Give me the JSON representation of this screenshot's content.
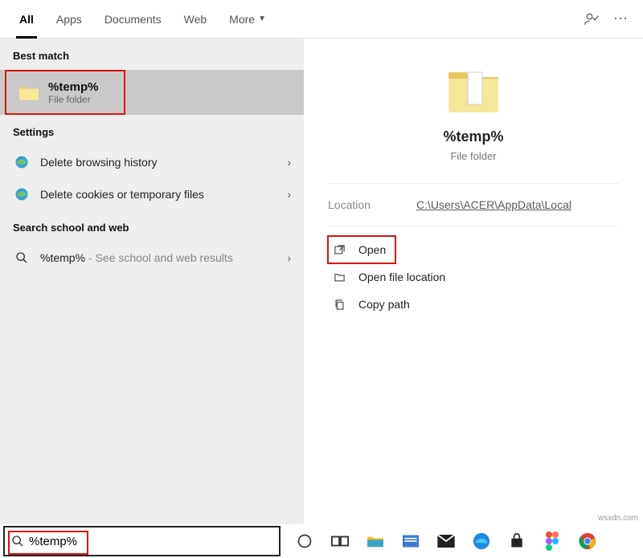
{
  "tabs": {
    "items": [
      "All",
      "Apps",
      "Documents",
      "Web",
      "More"
    ],
    "active_index": 0
  },
  "left": {
    "best_match_label": "Best match",
    "best_match": {
      "title": "%temp%",
      "subtitle": "File folder"
    },
    "settings_label": "Settings",
    "settings": [
      "Delete browsing history",
      "Delete cookies or temporary files"
    ],
    "school_web_label": "Search school and web",
    "school_web": {
      "title": "%temp%",
      "suffix": " - See school and web results"
    }
  },
  "right": {
    "title": "%temp%",
    "subtitle": "File folder",
    "location_label": "Location",
    "location_value": "C:\\Users\\ACER\\AppData\\Local",
    "actions": [
      "Open",
      "Open file location",
      "Copy path"
    ]
  },
  "search": {
    "value": "%temp%"
  },
  "watermark": "wsxdn.com"
}
